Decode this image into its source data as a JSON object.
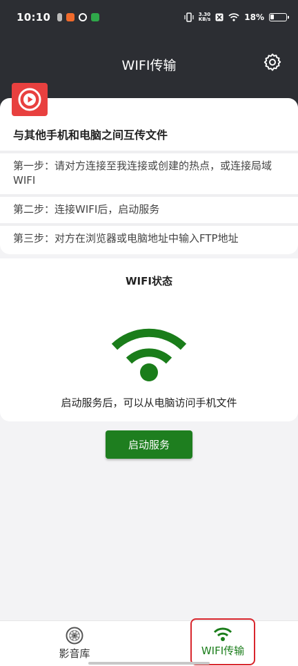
{
  "status_bar": {
    "time": "10:10",
    "net_speed_value": "3.30",
    "net_speed_unit": "KB/s",
    "battery": "18%"
  },
  "header": {
    "title": "WIFI传输",
    "settings_icon": "gear-icon"
  },
  "intro": {
    "headline": "与其他手机和电脑之间互传文件",
    "steps": [
      "第一步：请对方连接至我连接或创建的热点，或连接局域WIFI",
      "第二步：连接WIFI后，启动服务",
      "第三步：对方在浏览器或电脑地址中输入FTP地址"
    ]
  },
  "wifi_status": {
    "title": "WIFI状态",
    "hint": "启动服务后，可以从电脑访问手机文件"
  },
  "actions": {
    "start_label": "启动服务"
  },
  "bottom_nav": {
    "items": [
      {
        "label": "影音库",
        "icon": "film-reel-icon"
      },
      {
        "label": "WIFI传输",
        "icon": "wifi-icon"
      }
    ]
  },
  "colors": {
    "header_bg": "#2c2e33",
    "accent_green": "#1e7e1f",
    "logo_red": "#e8403f",
    "highlight_red": "#d8252c"
  }
}
